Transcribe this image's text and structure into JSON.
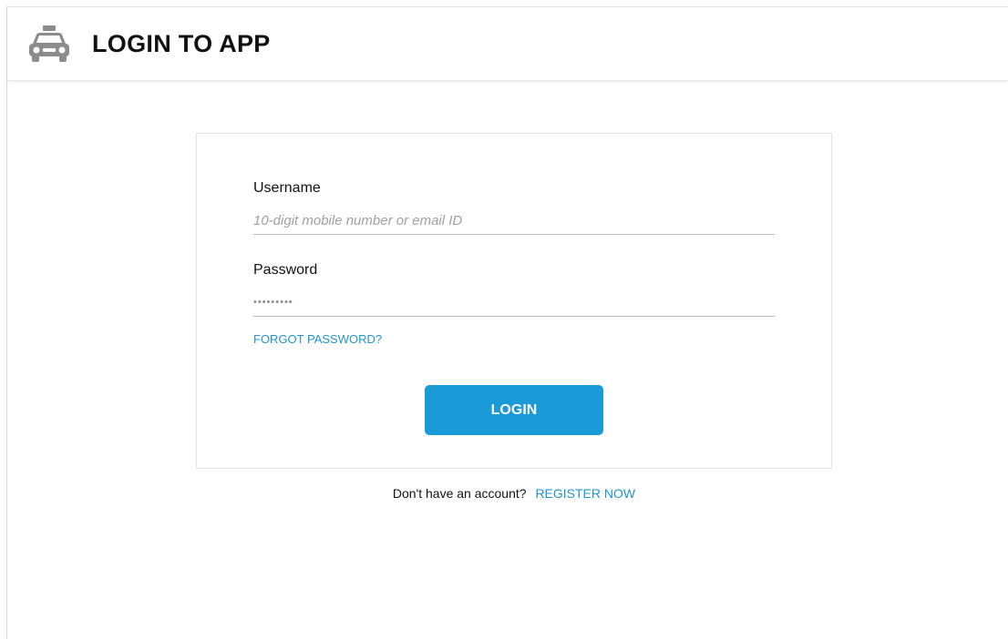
{
  "header": {
    "title": "LOGIN TO APP",
    "icon": "taxi-icon"
  },
  "form": {
    "username_label": "Username",
    "username_placeholder": "10-digit mobile number or email ID",
    "username_value": "",
    "password_label": "Password",
    "password_value": "•••••••••",
    "forgot_link": "FORGOT PASSWORD?",
    "login_button": "LOGIN"
  },
  "footer": {
    "prompt": "Don't have an account?",
    "register_link": "REGISTER NOW"
  },
  "colors": {
    "accent": "#1a9bd7",
    "link": "#1f94cf",
    "icon": "#8c8c8c"
  }
}
